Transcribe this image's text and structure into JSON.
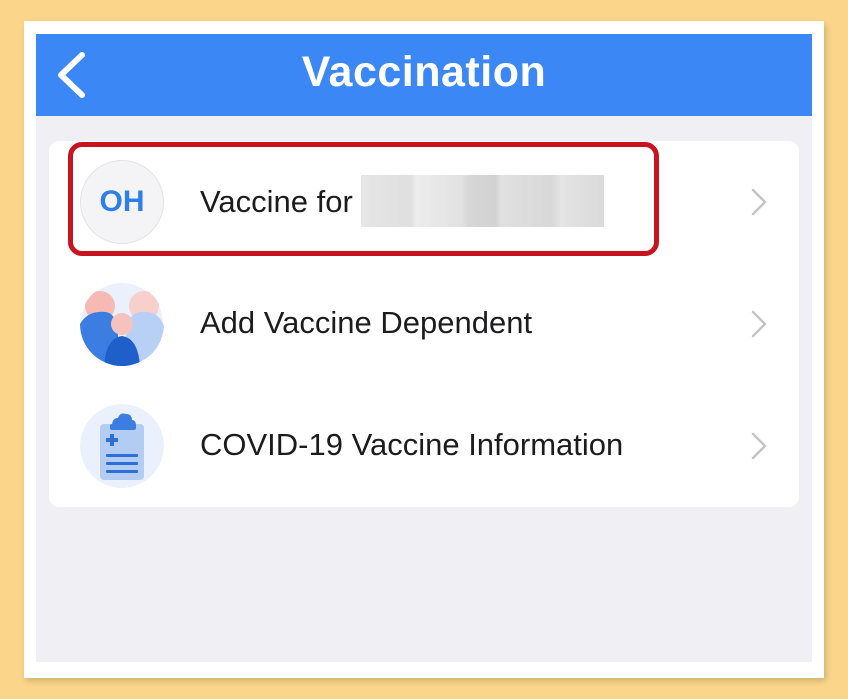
{
  "navbar": {
    "title": "Vaccination",
    "back_icon": "chevron-left-icon"
  },
  "rows": [
    {
      "avatar_text": "OH",
      "label": "Vaccine for",
      "redacted": true,
      "chevron_icon": "chevron-right-icon"
    },
    {
      "avatar_icon": "dependents-icon",
      "label": "Add Vaccine Dependent",
      "chevron_icon": "chevron-right-icon"
    },
    {
      "avatar_icon": "clipboard-medical-icon",
      "label": "COVID-19 Vaccine Information",
      "chevron_icon": "chevron-right-icon"
    }
  ],
  "colors": {
    "navbar": "#3b87f5",
    "background": "#efeff4",
    "highlight": "#c8141e",
    "page_border": "#fbd68a"
  }
}
